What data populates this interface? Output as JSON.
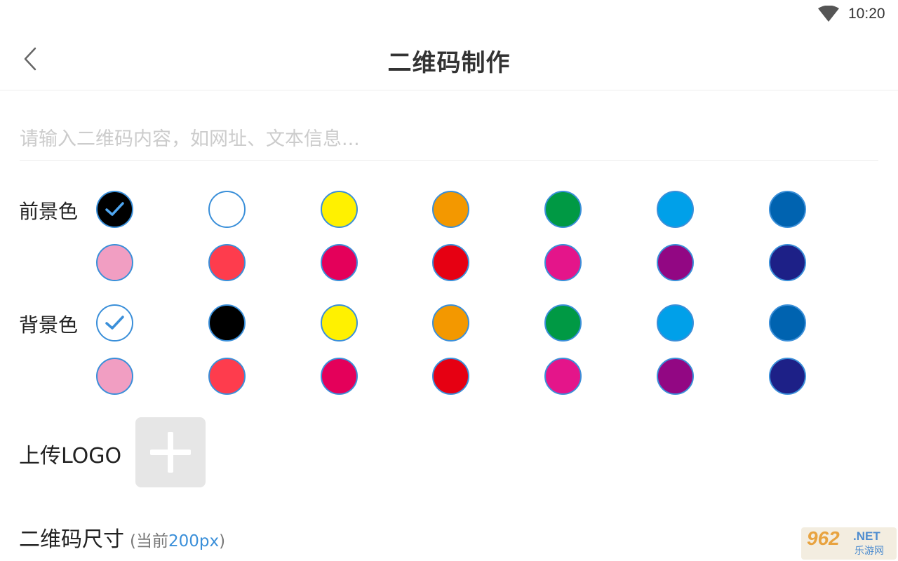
{
  "status_bar": {
    "time": "10:20",
    "wifi_icon": "wifi-icon"
  },
  "header": {
    "title": "二维码制作",
    "back_icon": "chevron-left-icon"
  },
  "content_input": {
    "placeholder": "请输入二维码内容，如网址、文本信息...",
    "value": ""
  },
  "foreground": {
    "label": "前景色",
    "selected": 0,
    "colors": [
      "#000000",
      "#ffffff",
      "#fff100",
      "#f39800",
      "#009944",
      "#00a0e9",
      "#0063b0",
      "#f19ec2",
      "#fe3c4d",
      "#e4005a",
      "#e60012",
      "#e4158a",
      "#920783",
      "#1d2087"
    ]
  },
  "background": {
    "label": "背景色",
    "selected": 0,
    "colors": [
      "#ffffff",
      "#000000",
      "#fff100",
      "#f39800",
      "#009944",
      "#00a0e9",
      "#0063b0",
      "#f19ec2",
      "#fe3c4d",
      "#e4005a",
      "#e60012",
      "#e4158a",
      "#920783",
      "#1d2087"
    ]
  },
  "logo": {
    "label": "上传LOGO",
    "add_icon": "plus-icon"
  },
  "size": {
    "label": "二维码尺寸",
    "note_open": "(当前",
    "value": "200px",
    "note_close": ")"
  },
  "watermark": {
    "brand": "962",
    "domain": ".NET",
    "name": "乐游网"
  }
}
